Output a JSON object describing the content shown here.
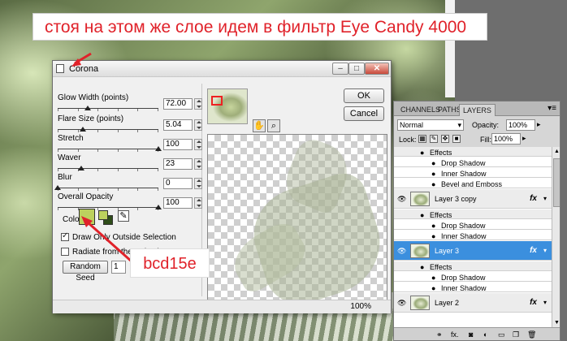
{
  "caption": "стоя на этом же слое идем в фильтр Eye Candy 4000",
  "annotation": {
    "label": "bcd15e",
    "color": "#e0222a",
    "swatch_color": "#bcd15e"
  },
  "dialog": {
    "title": "Corona",
    "ok_label": "OK",
    "cancel_label": "Cancel",
    "params": [
      {
        "label": "Glow Width (points)",
        "value": "72.00",
        "level": 0.3
      },
      {
        "label": "Flare Size (points)",
        "value": "5.04",
        "level": 0.25
      },
      {
        "label": "Stretch",
        "value": "100",
        "level": 1.0
      },
      {
        "label": "Waver",
        "value": "23",
        "level": 0.23
      },
      {
        "label": "Blur",
        "value": "0",
        "level": 0.0
      },
      {
        "label": "Overall Opacity",
        "value": "100",
        "level": 1.0
      }
    ],
    "color_label": "Color",
    "draw_only_outside": {
      "label": "Draw Only Outside Selection",
      "checked": true
    },
    "radiate": {
      "label": "Radiate from the Selection",
      "checked": false
    },
    "random_seed_label": "Random Seed",
    "random_seed_value": "1",
    "zoom": "100%"
  },
  "layers": {
    "tabs": [
      "CHANNELS",
      "PATHS",
      "LAYERS"
    ],
    "active_tab": "LAYERS",
    "blend_mode": "Normal",
    "opacity_label": "Opacity:",
    "opacity_value": "100%",
    "lock_label": "Lock:",
    "fill_label": "Fill:",
    "fill_value": "100%",
    "rows": [
      {
        "kind": "effects",
        "text": "Effects"
      },
      {
        "kind": "effect",
        "text": "Drop Shadow"
      },
      {
        "kind": "effect",
        "text": "Inner Shadow"
      },
      {
        "kind": "effect",
        "text": "Bevel and Emboss"
      },
      {
        "kind": "layer",
        "text": "Layer 3 copy"
      },
      {
        "kind": "effects",
        "text": "Effects"
      },
      {
        "kind": "effect",
        "text": "Drop Shadow"
      },
      {
        "kind": "effect",
        "text": "Inner Shadow"
      },
      {
        "kind": "layer",
        "text": "Layer 3",
        "selected": true
      },
      {
        "kind": "effects",
        "text": "Effects"
      },
      {
        "kind": "effect",
        "text": "Drop Shadow"
      },
      {
        "kind": "effect",
        "text": "Inner Shadow"
      },
      {
        "kind": "layer",
        "text": "Layer 2"
      }
    ],
    "fx_label": "fx",
    "selection_color": "#3b8fde"
  }
}
